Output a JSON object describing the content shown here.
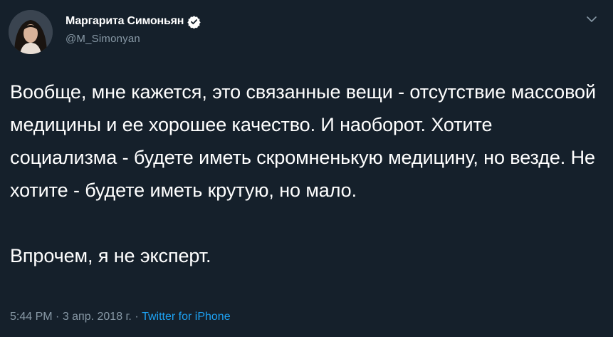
{
  "tweet": {
    "author": {
      "display_name": "Маргарита Симоньян",
      "handle": "@M_Simonyan",
      "verified": true
    },
    "paragraphs": [
      "Вообще, мне кажется, это связанные вещи - отсутствие массовой медицины и ее хорошее качество. И наоборот. Хотите социализма - будете иметь скромненькую медицину, но везде. Не хотите - будете иметь крутую, но мало.",
      "Впрочем, я не эксперт."
    ],
    "time": "5:44 PM",
    "separator": " · ",
    "date": "3 апр. 2018 г.",
    "source": "Twitter for iPhone"
  },
  "icons": {
    "verified": "verified-badge-icon",
    "menu": "chevron-down-icon"
  },
  "colors": {
    "background": "#15202b",
    "text": "#ffffff",
    "muted": "#8899a6",
    "link": "#1da1f2"
  }
}
